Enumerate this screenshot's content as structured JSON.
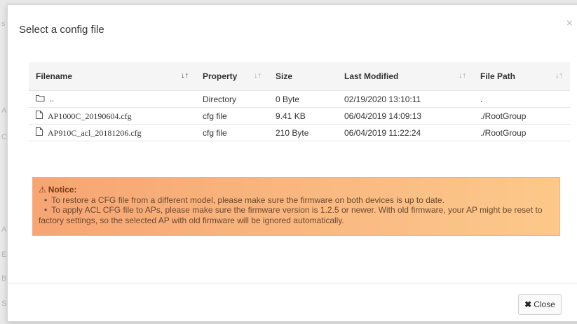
{
  "background": {
    "side_letters": [
      "s",
      "A",
      "C",
      "A",
      "E",
      "B",
      "S"
    ]
  },
  "modal": {
    "title": "Select a config file",
    "close_glyph": "×"
  },
  "table": {
    "columns": [
      {
        "label": "Filename",
        "sort": "active"
      },
      {
        "label": "Property",
        "sort": "inactive"
      },
      {
        "label": "Size",
        "sort": "none"
      },
      {
        "label": "Last Modified",
        "sort": "inactive"
      },
      {
        "label": "File Path",
        "sort": "inactive"
      }
    ],
    "rows": [
      {
        "icon": "folder-icon",
        "filename": "..",
        "property": "Directory",
        "size": "0 Byte",
        "modified": "02/19/2020 13:10:11",
        "path": "."
      },
      {
        "icon": "file-icon",
        "filename": "AP1000C_20190604.cfg",
        "property": "cfg file",
        "size": "9.41 KB",
        "modified": "06/04/2019 14:09:13",
        "path": "./RootGroup"
      },
      {
        "icon": "file-icon",
        "filename": "AP910C_acl_20181206.cfg",
        "property": "cfg file",
        "size": "210 Byte",
        "modified": "06/04/2019 11:22:24",
        "path": "./RootGroup"
      }
    ]
  },
  "notice": {
    "title": "Notice:",
    "items": [
      "To restore a CFG file from a different model, please make sure the firmware on both devices is up to date.",
      "To apply ACL CFG file to APs, please make sure the firmware version is 1.2.5 or newer. With old firmware, your AP might be reset to factory settings, so the selected AP with old firmware will be ignored automatically."
    ],
    "colors": {
      "start": "#f6a573",
      "end": "#fcc98b"
    }
  },
  "footer": {
    "close_label": "Close"
  }
}
